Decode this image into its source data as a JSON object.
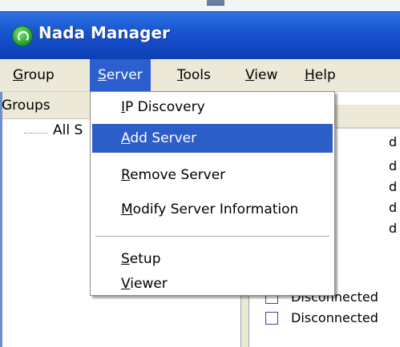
{
  "window": {
    "title": "Nada Manager"
  },
  "menubar": {
    "items": [
      {
        "mnemonic": "G",
        "rest": "roup"
      },
      {
        "mnemonic": "S",
        "rest": "erver"
      },
      {
        "mnemonic": "T",
        "rest": "ools"
      },
      {
        "mnemonic": "V",
        "rest": "iew"
      },
      {
        "mnemonic": "H",
        "rest": "elp"
      }
    ],
    "active_index": 1
  },
  "groups_pane": {
    "header": "Groups",
    "tree_item": "All S"
  },
  "right_pane": {
    "column_header_partial": "n",
    "rows": [
      {
        "text": "d"
      },
      {
        "text": "d"
      },
      {
        "text": "d"
      },
      {
        "text": "d"
      },
      {
        "text": "d"
      },
      {
        "text": "Disconnected"
      },
      {
        "text": "Disconnected"
      }
    ]
  },
  "server_menu": {
    "items": [
      {
        "mnemonic": "I",
        "rest": "P Discovery",
        "highlighted": false
      },
      {
        "mnemonic": "A",
        "rest": "dd Server",
        "highlighted": true
      },
      {
        "mnemonic": "R",
        "rest": "emove Server",
        "highlighted": false
      },
      {
        "mnemonic": "M",
        "rest": "odify Server Information",
        "highlighted": false
      },
      {
        "mnemonic": "S",
        "rest": "etup",
        "highlighted": false
      },
      {
        "mnemonic": "V",
        "rest": "iewer",
        "highlighted": false
      }
    ]
  },
  "colors": {
    "titlebar": "#1a54d0",
    "menu_highlight": "#2d5ec8",
    "window_bg": "#ece9d8"
  }
}
